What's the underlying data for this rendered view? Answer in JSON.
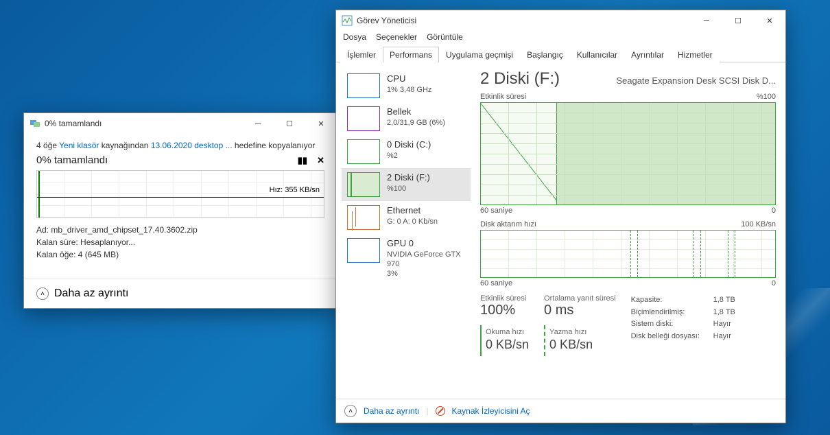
{
  "copy": {
    "title": "0%  tamamlandı",
    "line_prefix": "4 öğe ",
    "src": "Yeni klasör",
    "mid": " kaynağından ",
    "dst": "13.06.2020 desktop ...",
    "suffix": " hedefine kopyalanıyor",
    "progress": "0%  tamamlandı",
    "speed": "Hız: 355 KB/sn",
    "name_label": "Ad:  ",
    "name_val": "mb_driver_amd_chipset_17.40.3602.zip",
    "time_label": "Kalan süre:  ",
    "time_val": "Hesaplanıyor...",
    "remain_label": "Kalan öğe:  ",
    "remain_val": "4 (645 MB)",
    "less": "Daha az ayrıntı"
  },
  "tm": {
    "title": "Görev Yöneticisi",
    "menu": [
      "Dosya",
      "Seçenekler",
      "Görüntüle"
    ],
    "tabs": [
      "İşlemler",
      "Performans",
      "Uygulama geçmişi",
      "Başlangıç",
      "Kullanıcılar",
      "Ayrıntılar",
      "Hizmetler"
    ],
    "sidebar": [
      {
        "title": "CPU",
        "sub": "1% 3,48 GHz"
      },
      {
        "title": "Bellek",
        "sub": "2,0/31,9 GB (6%)"
      },
      {
        "title": "0 Diski (C:)",
        "sub": "%2"
      },
      {
        "title": "2 Diski (F:)",
        "sub": "%100"
      },
      {
        "title": "Ethernet",
        "sub": "G: 0 A: 0 Kb/sn"
      },
      {
        "title": "GPU 0",
        "sub": "NVIDIA GeForce GTX 970\n3%"
      }
    ],
    "detail": {
      "title": "2 Diski (F:)",
      "sub": "Seagate Expansion Desk SCSI Disk D...",
      "chart1_label": "Etkinlik süresi",
      "chart1_max": "%100",
      "axis_left": "60 saniye",
      "axis_right": "0",
      "chart2_label": "Disk aktarım hızı",
      "chart2_max": "100 KB/sn",
      "stats": {
        "activity_label": "Etkinlik süresi",
        "activity_val": "100%",
        "resp_label": "Ortalama yanıt süresi",
        "resp_val": "0 ms",
        "read_label": "Okuma hızı",
        "read_val": "0 KB/sn",
        "write_label": "Yazma hızı",
        "write_val": "0 KB/sn"
      },
      "info": [
        {
          "k": "Kapasite:",
          "v": "1,8 TB"
        },
        {
          "k": "Biçimlendirilmiş:",
          "v": "1,8 TB"
        },
        {
          "k": "Sistem diski:",
          "v": "Hayır"
        },
        {
          "k": "Disk belleği dosyası:",
          "v": "Hayır"
        }
      ]
    },
    "footer": {
      "less": "Daha az ayrıntı",
      "monitor": "Kaynak İzleyicisini Aç"
    }
  },
  "chart_data": [
    {
      "type": "line",
      "title": "Copy speed",
      "ylabel": "KB/sn",
      "x_seconds": 60,
      "current_value": 355,
      "series": [
        {
          "name": "speed",
          "values": [
            355
          ]
        }
      ]
    },
    {
      "type": "area",
      "title": "Etkinlik süresi",
      "ylim": [
        0,
        100
      ],
      "x_seconds": 60,
      "series": [
        {
          "name": "disk-activity-%",
          "values": [
            0,
            0,
            0,
            0,
            0,
            0,
            0,
            0,
            0,
            100,
            100,
            100,
            100,
            100,
            100,
            100,
            100,
            100,
            100,
            100,
            100,
            100,
            100,
            100,
            100,
            100,
            100,
            100,
            100,
            100
          ]
        }
      ]
    },
    {
      "type": "line",
      "title": "Disk aktarım hızı",
      "ylabel": "KB/sn",
      "ylim": [
        0,
        100
      ],
      "x_seconds": 60,
      "series": [
        {
          "name": "read",
          "values": [
            0,
            0,
            0,
            0,
            0,
            0,
            0,
            0,
            0,
            0,
            0,
            0,
            0,
            0,
            0,
            0,
            0,
            0,
            0,
            0,
            0,
            0,
            0,
            0,
            0,
            0,
            0,
            0,
            0,
            0
          ]
        },
        {
          "name": "write",
          "values": [
            0,
            0,
            0,
            0,
            0,
            0,
            0,
            0,
            0,
            0,
            0,
            0,
            0,
            0,
            0,
            0,
            0,
            0,
            0,
            0,
            0,
            0,
            0,
            0,
            0,
            0,
            0,
            0,
            0,
            0
          ]
        }
      ]
    }
  ]
}
